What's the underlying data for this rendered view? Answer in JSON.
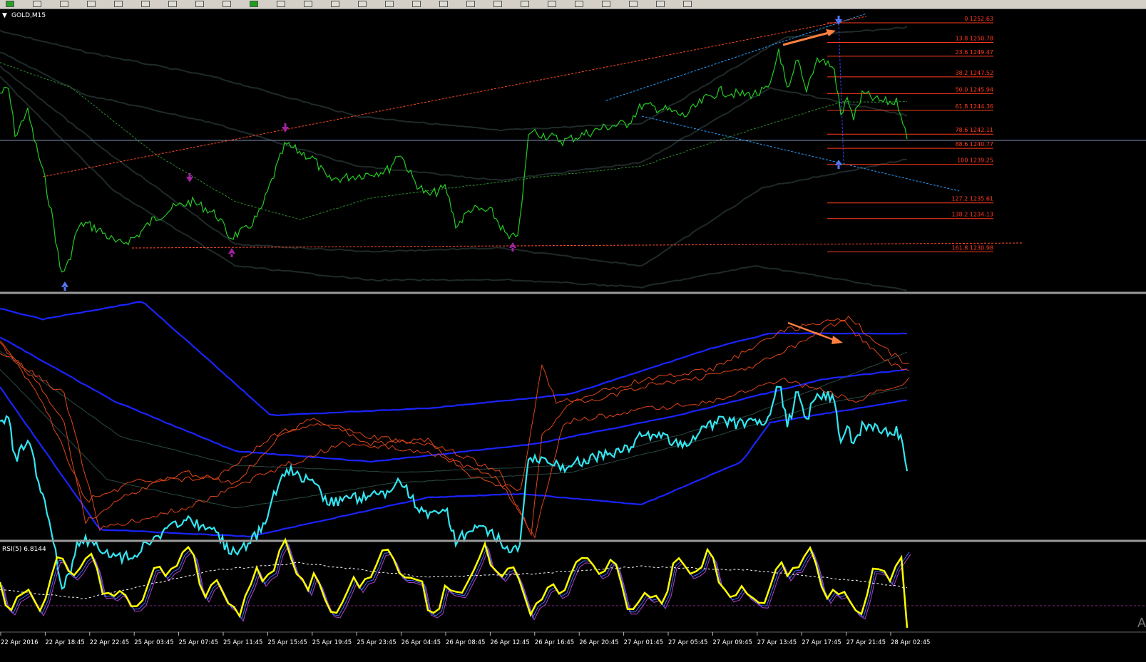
{
  "toolbar": {
    "icons": [
      "new-chart-icon",
      "profiles-icon",
      "zoom-in-icon",
      "zoom-out-icon",
      "tile-icon",
      "grid-icon",
      "crosshair-icon",
      "text-icon",
      "line-icon",
      "new-order-icon",
      "autotrading-icon",
      "period-icon",
      "cursor-icon",
      "trendline-icon",
      "channel-icon",
      "fibo-icon",
      "arrow-icon",
      "timeframe-M1",
      "timeframe-M5",
      "timeframe-M15",
      "timeframe-M30",
      "timeframe-H1",
      "timeframe-H4",
      "timeframe-D1",
      "timeframe-W1",
      "timeframe-MN"
    ]
  },
  "main_panel": {
    "title": "GOLD,M15",
    "fib_levels": [
      {
        "label": "0 1252.63",
        "price": 1252.63
      },
      {
        "label": "13.8 1250.78",
        "price": 1250.78
      },
      {
        "label": "23.6 1249.47",
        "price": 1249.47
      },
      {
        "label": "38.2 1247.52",
        "price": 1247.52
      },
      {
        "label": "50.0 1245.94",
        "price": 1245.94
      },
      {
        "label": "61.8 1244.36",
        "price": 1244.36
      },
      {
        "label": "78.6 1242.11",
        "price": 1242.11
      },
      {
        "label": "88.6 1240.77",
        "price": 1240.77
      },
      {
        "label": "100 1239.25",
        "price": 1239.25
      },
      {
        "label": "127.2 1235.61",
        "price": 1235.61
      },
      {
        "label": "138.2 1234.13",
        "price": 1234.13
      },
      {
        "label": "161.8 1230.98",
        "price": 1230.98
      }
    ]
  },
  "rsi_panel": {
    "title": "RSI(5) 6.8144"
  },
  "time_axis": [
    "22 Apr 2016",
    "22 Apr 18:45",
    "22 Apr 22:45",
    "25 Apr 03:45",
    "25 Apr 07:45",
    "25 Apr 11:45",
    "25 Apr 15:45",
    "25 Apr 19:45",
    "25 Apr 23:45",
    "26 Apr 04:45",
    "26 Apr 08:45",
    "26 Apr 12:45",
    "26 Apr 16:45",
    "26 Apr 20:45",
    "27 Apr 01:45",
    "27 Apr 05:45",
    "27 Apr 09:45",
    "27 Apr 13:45",
    "27 Apr 17:45",
    "27 Apr 21:45",
    "28 Apr 02:45"
  ],
  "colors": {
    "background": "#000000",
    "price_line": "#22cc22",
    "fib": "#ff3a1e",
    "cyan_line": "#33e6f2",
    "blue_band": "#1a24ff",
    "rsi_line": "#ffff00",
    "arrow_orange": "#ff8040",
    "trend_blue": "#2aa0ff",
    "marker_purple": "#a020a0",
    "marker_blue": "#5577ff"
  },
  "watermark": "A"
}
